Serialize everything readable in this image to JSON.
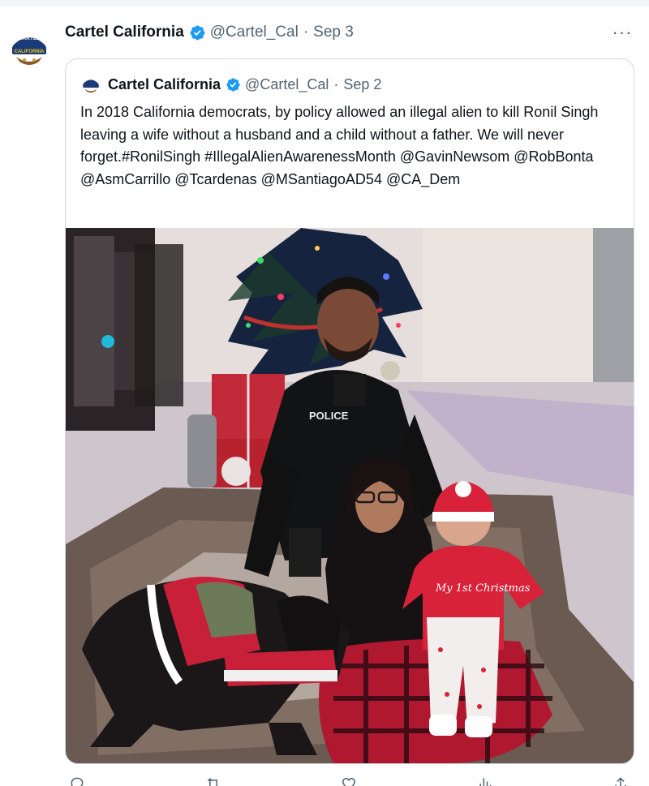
{
  "tweet": {
    "author_name": "Cartel California",
    "author_handle": "@Cartel_Cal",
    "separator": "·",
    "date": "Sep 3",
    "more_label": "···",
    "avatar_text": "CARTEL CALIFORNIA"
  },
  "quote": {
    "author_name": "Cartel California",
    "author_handle": "@Cartel_Cal",
    "separator": "·",
    "date": "Sep 2",
    "text": "In 2018 California democrats, by policy allowed an illegal alien to kill Ronil Singh leaving a wife without a husband and a child without a father. We will never forget.#RonilSingh #IllegalAlienAwarenessMonth @GavinNewsom @RobBonta @AsmCarrillo @Tcardenas @MSantiagoAD54 @CA_Dem",
    "media": {
      "patch_text": "POLICE",
      "onesie_text": "My 1st Christmas"
    }
  },
  "icons": {
    "verified": "verified-badge-icon",
    "reply": "reply-icon",
    "retweet": "retweet-icon",
    "like": "like-icon",
    "views": "views-icon",
    "share": "share-icon"
  },
  "colors": {
    "verified": "#1d9bf0",
    "secondary_text": "#536471",
    "border": "#cfd9de"
  }
}
